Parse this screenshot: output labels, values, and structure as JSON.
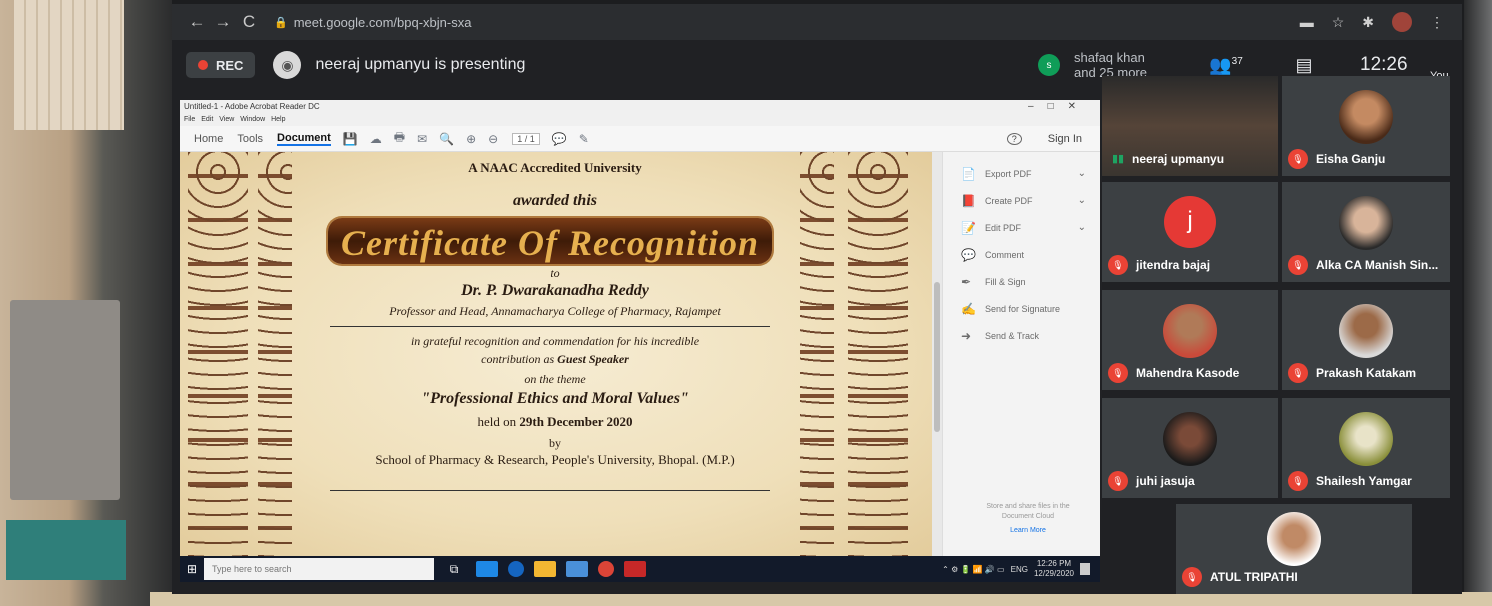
{
  "browser": {
    "url": "meet.google.com/bpq-xbjn-sxa",
    "nav": {
      "back": "←",
      "forward": "→",
      "reload": "C"
    },
    "lock_icon": "🔒",
    "ext_icons": [
      "▬",
      "☆",
      "✱",
      "⋮"
    ]
  },
  "meet": {
    "rec_label": "REC",
    "presenting_text": "neeraj upmanyu is presenting",
    "other_initial": "s",
    "other_names": "shafaq khan\nand 25 more",
    "people_count": "37",
    "people_icon": "👥",
    "chat_icon": "▤",
    "time": "12:26",
    "you_label": "You"
  },
  "acrobat": {
    "title": "Untitled-1 - Adobe Acrobat Reader DC",
    "window_controls": "–□✕",
    "menu": "File Edit View Window Help",
    "tabs": [
      "Home",
      "Tools",
      "Document"
    ],
    "toolbar_icons": [
      "💾",
      "☁",
      "🖶",
      "✉",
      "🔍",
      "⊕",
      "⊖"
    ],
    "page_indicator": "1 / 1",
    "comment_icon": "💬",
    "pen_icon": "✎",
    "help_icon": "?",
    "sign_in": "Sign In",
    "tools": [
      {
        "label": "Export PDF",
        "icon": "📄",
        "chevron": "⌄"
      },
      {
        "label": "Create PDF",
        "icon": "📕",
        "chevron": "⌄"
      },
      {
        "label": "Edit PDF",
        "icon": "📝",
        "chevron": "⌄"
      },
      {
        "label": "Comment",
        "icon": "💬",
        "chevron": ""
      },
      {
        "label": "Fill & Sign",
        "icon": "✒",
        "chevron": ""
      },
      {
        "label": "Send for Signature",
        "icon": "✍",
        "chevron": ""
      },
      {
        "label": "Send & Track",
        "icon": "➜",
        "chevron": ""
      }
    ],
    "promo_text": "Store and share files in the Document Cloud",
    "promo_link": "Learn More"
  },
  "certificate": {
    "university": "A NAAC Accredited University",
    "awarded": "awarded this",
    "title": "Certificate Of Recognition",
    "to": "to",
    "name": "Dr. P. Dwarakanadha Reddy",
    "designation": "Professor and Head, Annamacharya College of Pharmacy, Rajampet",
    "grateful": "in grateful recognition and commendation for his incredible",
    "contrib_prefix": "contribution as ",
    "contrib_role": "Guest Speaker",
    "theme_label": "on the theme",
    "theme": "\"Professional Ethics and Moral Values\"",
    "held_prefix": "held on ",
    "held_date": "29th December 2020",
    "by": "by",
    "school": "School of Pharmacy & Research, People's University, Bhopal. (M.P.)"
  },
  "taskbar": {
    "start_icon": "⊞",
    "search_placeholder": "Type here to search",
    "task_view_icon": "⧉",
    "lang": "ENG",
    "time": "12:26 PM",
    "date": "12/29/2020",
    "tray_icons": "⌃ ⚙ 🔋 📶 🔊 ▭"
  },
  "participants": [
    {
      "name": "neeraj upmanyu",
      "initial": "",
      "muted": false
    },
    {
      "name": "Eisha Ganju",
      "initial": "",
      "muted": true
    },
    {
      "name": "jitendra bajaj",
      "initial": "j",
      "muted": true
    },
    {
      "name": "Alka CA Manish Sin...",
      "initial": "",
      "muted": true
    },
    {
      "name": "Mahendra Kasode",
      "initial": "",
      "muted": true
    },
    {
      "name": "Prakash Katakam",
      "initial": "",
      "muted": true
    },
    {
      "name": "juhi jasuja",
      "initial": "",
      "muted": true
    },
    {
      "name": "Shailesh Yamgar",
      "initial": "",
      "muted": true
    },
    {
      "name": "ATUL TRIPATHI",
      "initial": "",
      "muted": true
    }
  ],
  "icons": {
    "mic_off": "🎙",
    "speaking": "▮▮"
  },
  "colors": {
    "meet_bg": "#202124",
    "rec_dot": "#ea4335",
    "accent_blue": "#1473e6",
    "muted_red": "#ea4335"
  }
}
